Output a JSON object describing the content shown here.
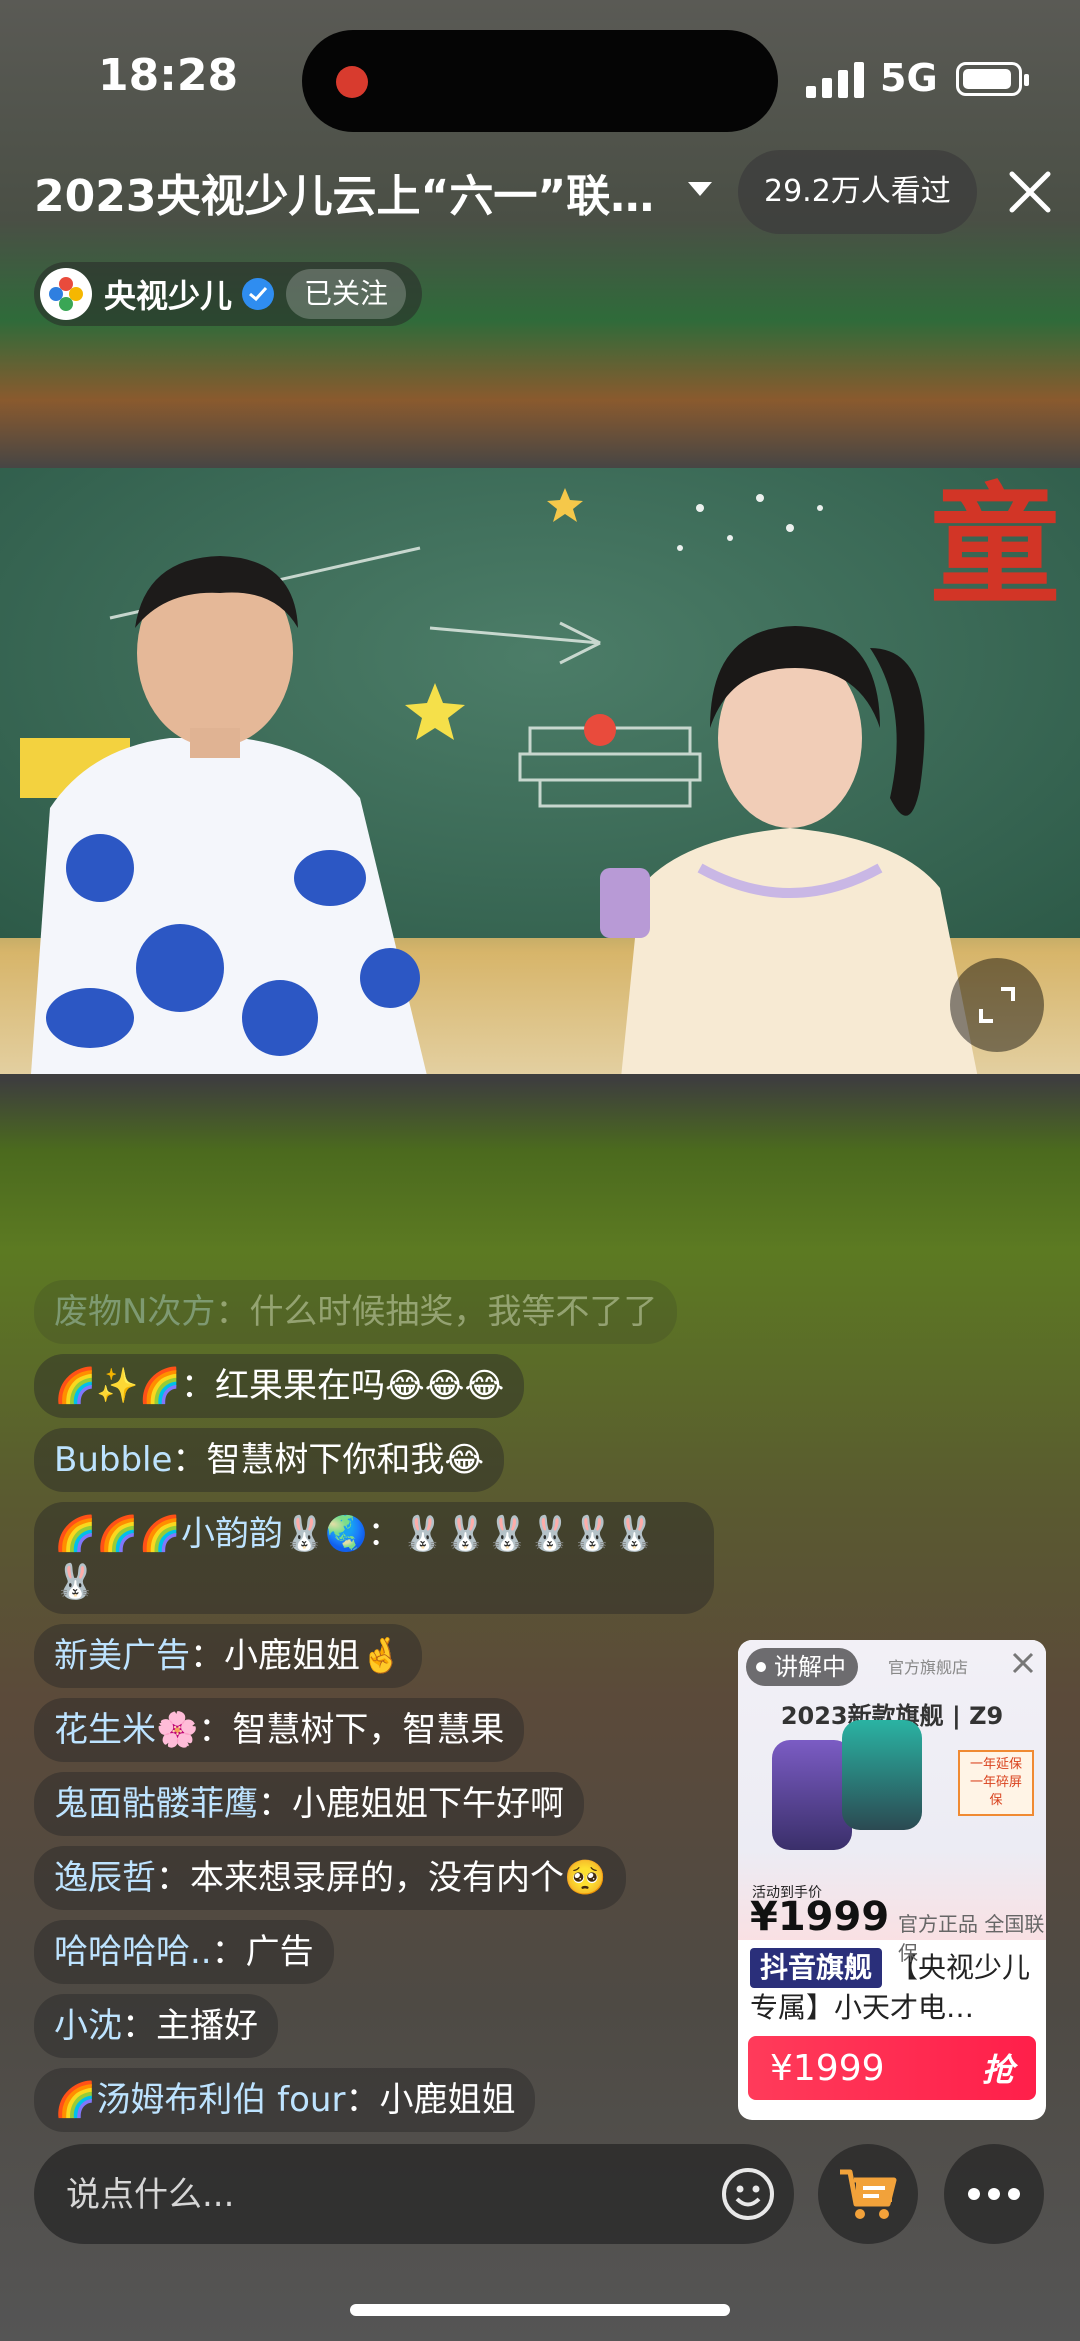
{
  "status_bar": {
    "time": "18:28",
    "network": "5G"
  },
  "header": {
    "title": "2023央视少儿云上“六一”联…",
    "viewers": "29.2万人看过",
    "channel_name": "央视少儿",
    "follow_label": "已关注"
  },
  "video": {
    "sign_text": "童"
  },
  "chat": [
    {
      "user": "废物N次方",
      "sep": "：",
      "text": "什么时候抽奖，我等不了了",
      "faded": true
    },
    {
      "user": "🌈✨🌈",
      "sep": "：",
      "text": "红果果在吗😂😂😂"
    },
    {
      "user": "Bubble",
      "sep": "：",
      "text": "智慧树下你和我😂"
    },
    {
      "user": "🌈🌈🌈小韵韵🐰🌏",
      "sep": "：",
      "text": "🐰🐰🐰🐰🐰🐰🐰"
    },
    {
      "user": "新美广告",
      "sep": "：",
      "text": "小鹿姐姐🤞"
    },
    {
      "user": "花生米🌸",
      "sep": "：",
      "text": "智慧树下，智慧果"
    },
    {
      "user": "鬼面骷髅菲鹰",
      "sep": "：",
      "text": "小鹿姐姐下午好啊"
    },
    {
      "user": "逸辰哲",
      "sep": "：",
      "text": "本来想录屏的，没有内个🥺"
    },
    {
      "user": "哈哈哈哈..",
      "sep": "：",
      "text": "广告"
    },
    {
      "user": "小沈",
      "sep": "：",
      "text": "主播好"
    },
    {
      "user": "🌈汤姆布利伯 four",
      "sep": "：",
      "text": "小鹿姐姐"
    }
  ],
  "product": {
    "badge": "讲解中",
    "shop_tag": "官方旗舰店",
    "model_line": "2023新款旗舰 | Z9",
    "side_tag": "一年延保 一年碎屏保",
    "price_label": "活动到手价",
    "price_big": "¥1999",
    "official": "官方正品 全国联保",
    "flagship_tag": "抖音旗舰",
    "title": "【央视少儿专属】小天才电…",
    "buy_price": "¥1999",
    "buy_cta": "抢"
  },
  "input": {
    "placeholder": "说点什么..."
  },
  "colors": {
    "accent_red": "#ff2d52",
    "follow_blue": "#2f8df0",
    "flagship_navy": "#2a2f7a"
  },
  "icons": [
    "signal-icon",
    "battery-icon",
    "caret-down-icon",
    "close-icon",
    "verified-icon",
    "fullscreen-icon",
    "emoji-icon",
    "cart-icon",
    "more-icon"
  ]
}
